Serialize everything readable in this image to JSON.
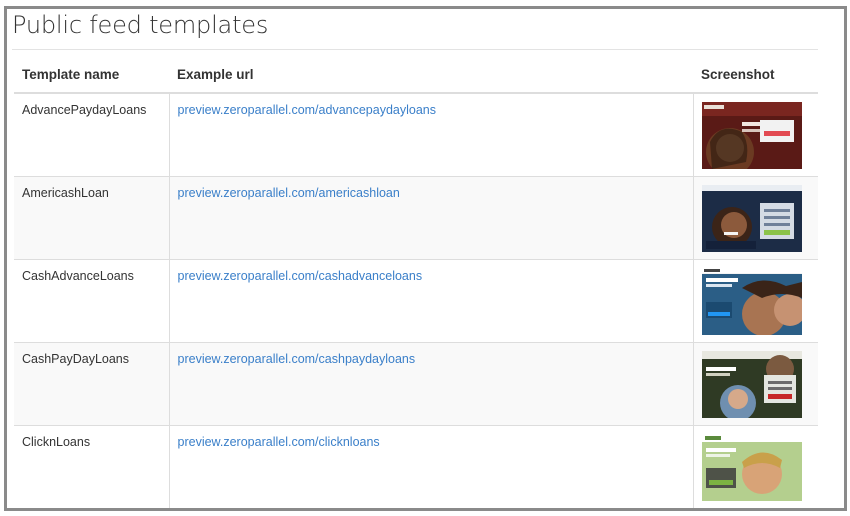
{
  "page": {
    "title": "Public feed templates"
  },
  "table": {
    "headers": {
      "name": "Template name",
      "url": "Example url",
      "screenshot": "Screenshot"
    },
    "rows": [
      {
        "name": "AdvancePaydayLoans",
        "url": "preview.zeroparallel.com/advancepaydayloans",
        "thumb_theme": "dark-red"
      },
      {
        "name": "AmericashLoan",
        "url": "preview.zeroparallel.com/americashloan",
        "thumb_theme": "navy"
      },
      {
        "name": "CashAdvanceLoans",
        "url": "preview.zeroparallel.com/cashadvanceloans",
        "thumb_theme": "blue"
      },
      {
        "name": "CashPayDayLoans",
        "url": "preview.zeroparallel.com/cashpaydayloans",
        "thumb_theme": "dark-green"
      },
      {
        "name": "ClicknLoans",
        "url": "preview.zeroparallel.com/clicknloans",
        "thumb_theme": "light-green"
      }
    ]
  },
  "colors": {
    "link": "#3a7fc9",
    "frame_border": "#8a8a8a",
    "row_alt": "#f9f9f9"
  }
}
